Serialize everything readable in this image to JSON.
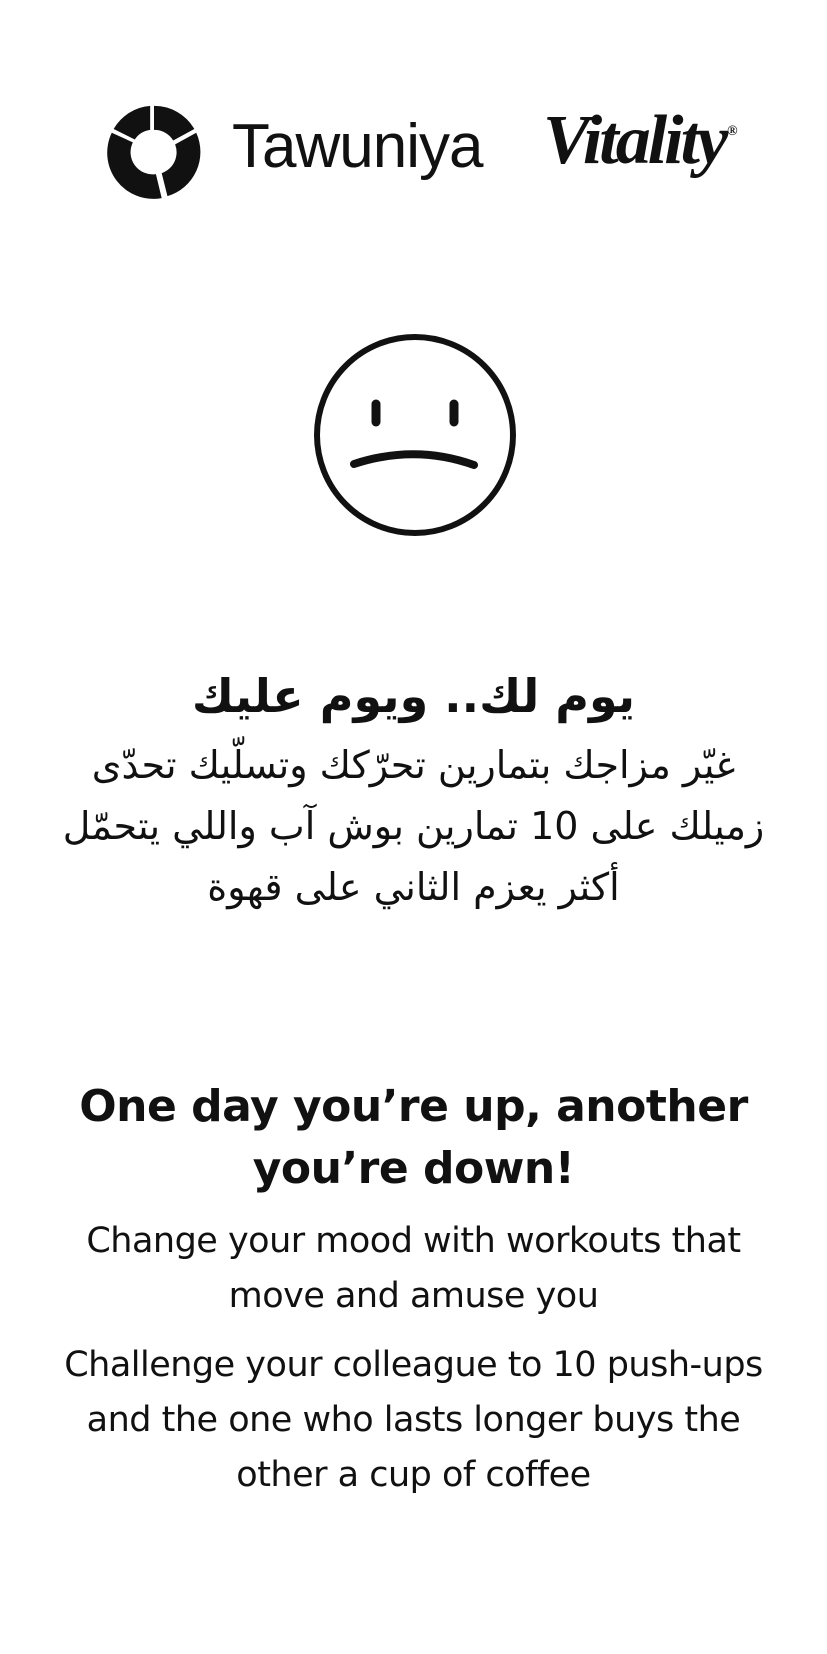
{
  "header": {
    "brand_primary": "Tawuniya",
    "brand_secondary": "Vitality",
    "registered_mark": "®",
    "logo_icon": "tawuniya-mark-icon"
  },
  "illustration": {
    "icon": "sad-face-icon"
  },
  "arabic": {
    "title": "يوم لك.. ويوم عليك",
    "body": "غيّر مزاجك بتمارين تحرّكك وتسلّيك تحدّى زميلك على 10 تمارين بوش آب واللي يتحمّل أكثر يعزم الثاني على قهوة"
  },
  "english": {
    "title": "One day you’re up, another you’re down!",
    "line1": "Change your mood with workouts that move and amuse you",
    "line2": "Challenge your colleague to 10 push-ups  and the one who lasts longer buys the other a cup of coffee"
  },
  "colors": {
    "text": "#111111",
    "background": "#ffffff"
  }
}
